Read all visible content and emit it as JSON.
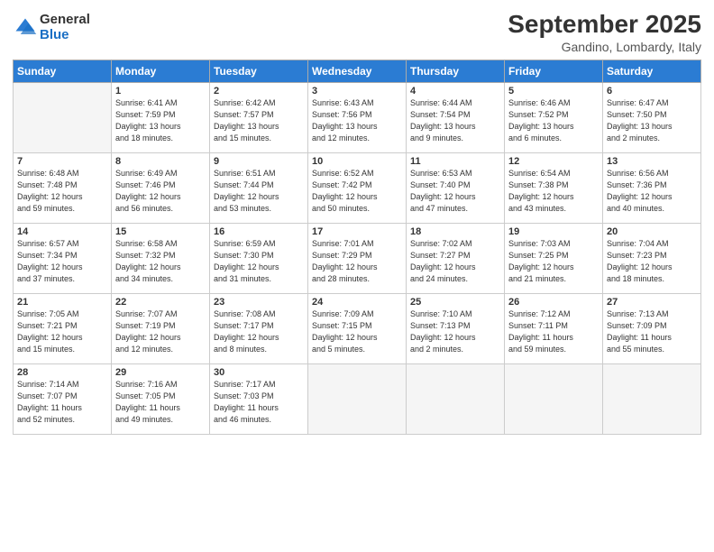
{
  "logo": {
    "general": "General",
    "blue": "Blue"
  },
  "title": "September 2025",
  "location": "Gandino, Lombardy, Italy",
  "headers": [
    "Sunday",
    "Monday",
    "Tuesday",
    "Wednesday",
    "Thursday",
    "Friday",
    "Saturday"
  ],
  "weeks": [
    [
      {
        "day": "",
        "info": ""
      },
      {
        "day": "1",
        "info": "Sunrise: 6:41 AM\nSunset: 7:59 PM\nDaylight: 13 hours\nand 18 minutes."
      },
      {
        "day": "2",
        "info": "Sunrise: 6:42 AM\nSunset: 7:57 PM\nDaylight: 13 hours\nand 15 minutes."
      },
      {
        "day": "3",
        "info": "Sunrise: 6:43 AM\nSunset: 7:56 PM\nDaylight: 13 hours\nand 12 minutes."
      },
      {
        "day": "4",
        "info": "Sunrise: 6:44 AM\nSunset: 7:54 PM\nDaylight: 13 hours\nand 9 minutes."
      },
      {
        "day": "5",
        "info": "Sunrise: 6:46 AM\nSunset: 7:52 PM\nDaylight: 13 hours\nand 6 minutes."
      },
      {
        "day": "6",
        "info": "Sunrise: 6:47 AM\nSunset: 7:50 PM\nDaylight: 13 hours\nand 2 minutes."
      }
    ],
    [
      {
        "day": "7",
        "info": "Sunrise: 6:48 AM\nSunset: 7:48 PM\nDaylight: 12 hours\nand 59 minutes."
      },
      {
        "day": "8",
        "info": "Sunrise: 6:49 AM\nSunset: 7:46 PM\nDaylight: 12 hours\nand 56 minutes."
      },
      {
        "day": "9",
        "info": "Sunrise: 6:51 AM\nSunset: 7:44 PM\nDaylight: 12 hours\nand 53 minutes."
      },
      {
        "day": "10",
        "info": "Sunrise: 6:52 AM\nSunset: 7:42 PM\nDaylight: 12 hours\nand 50 minutes."
      },
      {
        "day": "11",
        "info": "Sunrise: 6:53 AM\nSunset: 7:40 PM\nDaylight: 12 hours\nand 47 minutes."
      },
      {
        "day": "12",
        "info": "Sunrise: 6:54 AM\nSunset: 7:38 PM\nDaylight: 12 hours\nand 43 minutes."
      },
      {
        "day": "13",
        "info": "Sunrise: 6:56 AM\nSunset: 7:36 PM\nDaylight: 12 hours\nand 40 minutes."
      }
    ],
    [
      {
        "day": "14",
        "info": "Sunrise: 6:57 AM\nSunset: 7:34 PM\nDaylight: 12 hours\nand 37 minutes."
      },
      {
        "day": "15",
        "info": "Sunrise: 6:58 AM\nSunset: 7:32 PM\nDaylight: 12 hours\nand 34 minutes."
      },
      {
        "day": "16",
        "info": "Sunrise: 6:59 AM\nSunset: 7:30 PM\nDaylight: 12 hours\nand 31 minutes."
      },
      {
        "day": "17",
        "info": "Sunrise: 7:01 AM\nSunset: 7:29 PM\nDaylight: 12 hours\nand 28 minutes."
      },
      {
        "day": "18",
        "info": "Sunrise: 7:02 AM\nSunset: 7:27 PM\nDaylight: 12 hours\nand 24 minutes."
      },
      {
        "day": "19",
        "info": "Sunrise: 7:03 AM\nSunset: 7:25 PM\nDaylight: 12 hours\nand 21 minutes."
      },
      {
        "day": "20",
        "info": "Sunrise: 7:04 AM\nSunset: 7:23 PM\nDaylight: 12 hours\nand 18 minutes."
      }
    ],
    [
      {
        "day": "21",
        "info": "Sunrise: 7:05 AM\nSunset: 7:21 PM\nDaylight: 12 hours\nand 15 minutes."
      },
      {
        "day": "22",
        "info": "Sunrise: 7:07 AM\nSunset: 7:19 PM\nDaylight: 12 hours\nand 12 minutes."
      },
      {
        "day": "23",
        "info": "Sunrise: 7:08 AM\nSunset: 7:17 PM\nDaylight: 12 hours\nand 8 minutes."
      },
      {
        "day": "24",
        "info": "Sunrise: 7:09 AM\nSunset: 7:15 PM\nDaylight: 12 hours\nand 5 minutes."
      },
      {
        "day": "25",
        "info": "Sunrise: 7:10 AM\nSunset: 7:13 PM\nDaylight: 12 hours\nand 2 minutes."
      },
      {
        "day": "26",
        "info": "Sunrise: 7:12 AM\nSunset: 7:11 PM\nDaylight: 11 hours\nand 59 minutes."
      },
      {
        "day": "27",
        "info": "Sunrise: 7:13 AM\nSunset: 7:09 PM\nDaylight: 11 hours\nand 55 minutes."
      }
    ],
    [
      {
        "day": "28",
        "info": "Sunrise: 7:14 AM\nSunset: 7:07 PM\nDaylight: 11 hours\nand 52 minutes."
      },
      {
        "day": "29",
        "info": "Sunrise: 7:16 AM\nSunset: 7:05 PM\nDaylight: 11 hours\nand 49 minutes."
      },
      {
        "day": "30",
        "info": "Sunrise: 7:17 AM\nSunset: 7:03 PM\nDaylight: 11 hours\nand 46 minutes."
      },
      {
        "day": "",
        "info": ""
      },
      {
        "day": "",
        "info": ""
      },
      {
        "day": "",
        "info": ""
      },
      {
        "day": "",
        "info": ""
      }
    ]
  ]
}
